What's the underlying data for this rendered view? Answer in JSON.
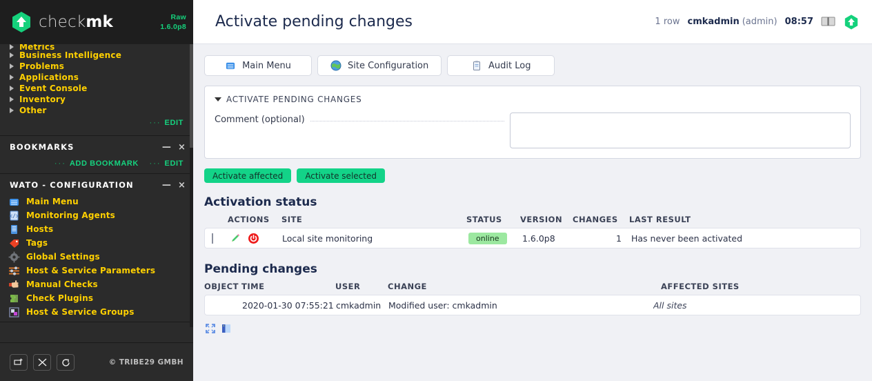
{
  "sidebar": {
    "logo": {
      "word_light": "check",
      "word_bold": "mk",
      "icon": "checkmk-hexagon-arrow-logo"
    },
    "edition": {
      "line1": "Raw",
      "line2": "1.6.0p8"
    },
    "views_snapin": {
      "clipped_item": "Metrics",
      "items": [
        {
          "label": "Business Intelligence",
          "icon": "triangle-right-icon"
        },
        {
          "label": "Problems",
          "icon": "triangle-right-icon"
        },
        {
          "label": "Applications",
          "icon": "triangle-right-icon"
        },
        {
          "label": "Event Console",
          "icon": "triangle-right-icon"
        },
        {
          "label": "Inventory",
          "icon": "triangle-right-icon"
        },
        {
          "label": "Other",
          "icon": "triangle-right-icon"
        }
      ],
      "edit_label": "EDIT",
      "dots": "···"
    },
    "bookmarks_snapin": {
      "title": "BOOKMARKS",
      "add_label": "ADD BOOKMARK",
      "edit_label": "EDIT",
      "dots": "···",
      "minimize": "—",
      "close": "×"
    },
    "wato_snapin": {
      "title": "WATO - CONFIGURATION",
      "minimize": "—",
      "close": "×",
      "items": [
        {
          "label": "Main Menu",
          "icon": "main-menu-icon"
        },
        {
          "label": "Monitoring Agents",
          "icon": "agents-code-icon"
        },
        {
          "label": "Hosts",
          "icon": "host-server-icon"
        },
        {
          "label": "Tags",
          "icon": "tag-icon"
        },
        {
          "label": "Global Settings",
          "icon": "gear-icon"
        },
        {
          "label": "Host & Service Parameters",
          "icon": "sliders-icon"
        },
        {
          "label": "Manual Checks",
          "icon": "hand-icon"
        },
        {
          "label": "Check Plugins",
          "icon": "puzzle-piece-icon"
        },
        {
          "label": "Host & Service Groups",
          "icon": "groups-icon"
        }
      ]
    },
    "footer": {
      "buttons": [
        {
          "name": "add-snapin-button",
          "icon": "add-snapin-icon"
        },
        {
          "name": "edit-sidebar-button",
          "icon": "scissors-icon"
        },
        {
          "name": "logout-button",
          "icon": "logout-icon"
        }
      ],
      "copyright": "© TRIBE29 GMBH"
    }
  },
  "header": {
    "title": "Activate pending changes",
    "row_count": "1 row",
    "user": "cmkadmin",
    "user_role": "(admin)",
    "time": "08:57",
    "help_icon": "help-book-icon",
    "logo_icon": "checkmk-hexagon-arrow-logo"
  },
  "tabs": [
    {
      "label": "Main Menu",
      "icon": "main-menu-icon"
    },
    {
      "label": "Site Configuration",
      "icon": "globe-icon"
    },
    {
      "label": "Audit Log",
      "icon": "clipboard-icon"
    }
  ],
  "activate_panel": {
    "heading": "ACTIVATE PENDING CHANGES",
    "caret": "caret-down-icon",
    "comment_label": "Comment (optional)",
    "comment_value": "",
    "comment_placeholder": ""
  },
  "actions": {
    "activate_affected": "Activate affected",
    "activate_selected": "Activate selected"
  },
  "activation_status": {
    "title": "Activation status",
    "columns": [
      "",
      "ACTIONS",
      "SITE",
      "STATUS",
      "VERSION",
      "CHANGES",
      "LAST RESULT"
    ],
    "rows": [
      {
        "checked": false,
        "edit_icon": "pencil-edit-icon",
        "restart_icon": "power-restart-icon",
        "site": "Local site monitoring",
        "status": "online",
        "version": "1.6.0p8",
        "changes": "1",
        "last_result": "Has never been activated"
      }
    ]
  },
  "pending_changes": {
    "title": "Pending changes",
    "columns": [
      "OBJECT",
      "TIME",
      "USER",
      "CHANGE",
      "AFFECTED SITES"
    ],
    "rows": [
      {
        "object": "",
        "time": "2020-01-30 07:55:21",
        "user": "cmkadmin",
        "change": "Modified user: cmkadmin",
        "affected_sites": "All sites"
      }
    ]
  },
  "footer_icons": [
    {
      "name": "expand-view-icon"
    },
    {
      "name": "toggle-sidebar-icon"
    }
  ],
  "colors": {
    "accent_green": "#13d388",
    "sidebar_bg": "#2b2b2b",
    "nav_yellow": "#ffd000",
    "title_navy": "#1c2a4d",
    "status_online": "#9ce8a0",
    "page_bg": "#f0f1f5"
  }
}
